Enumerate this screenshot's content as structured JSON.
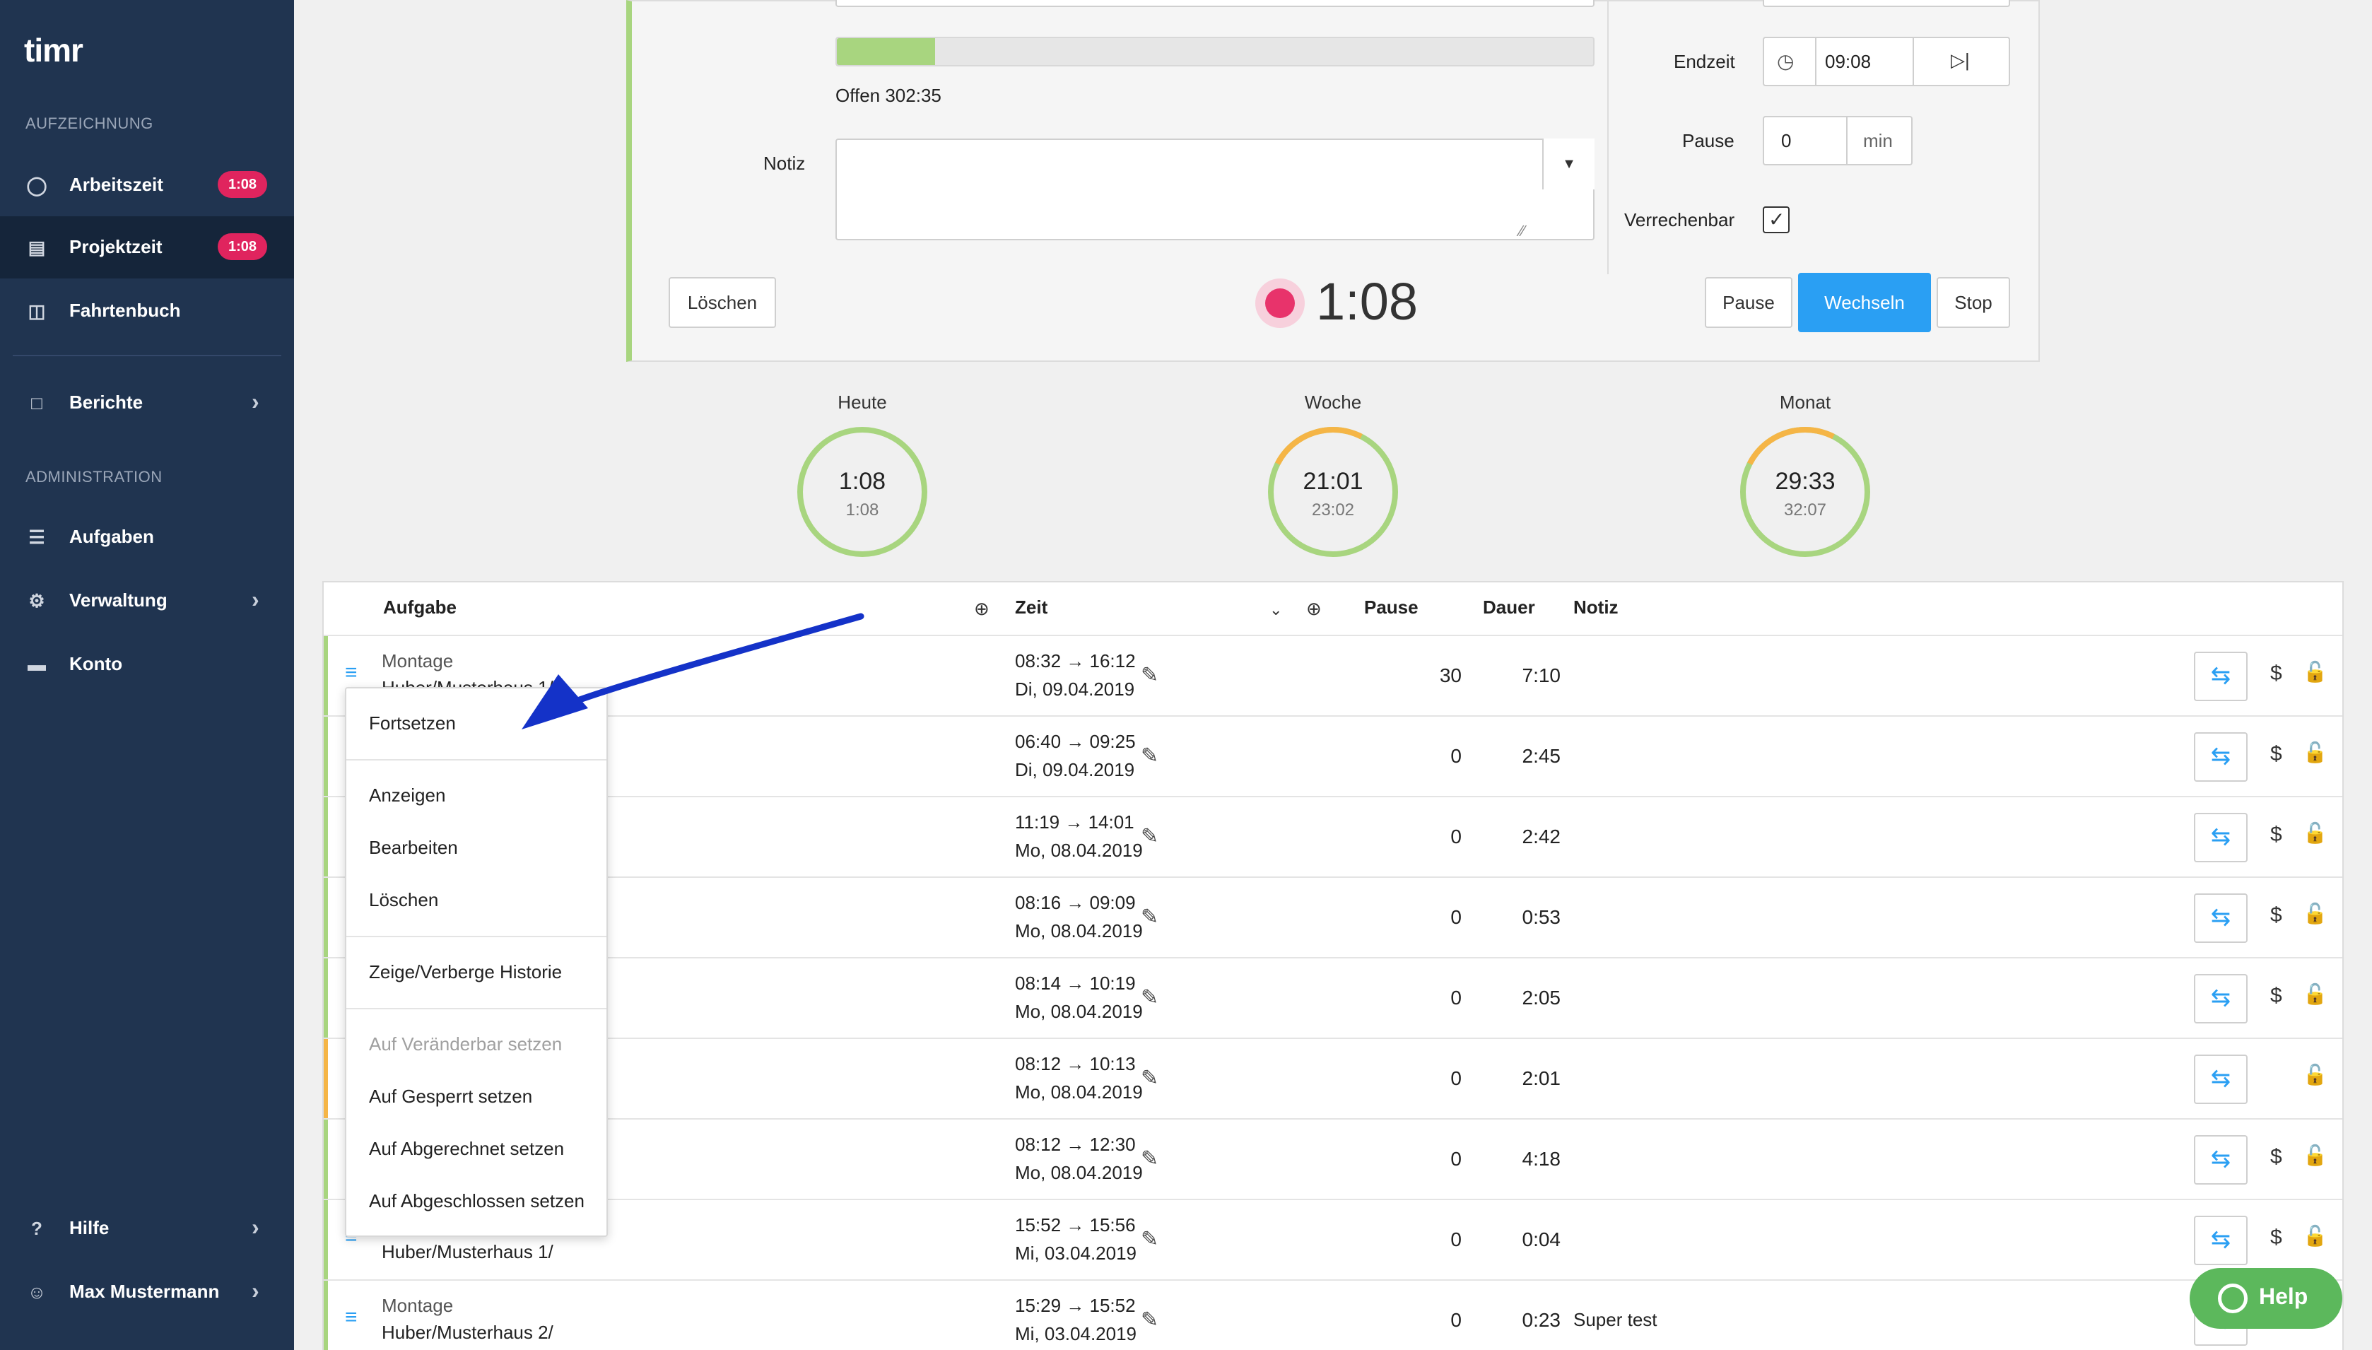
{
  "app": {
    "logo": "timr"
  },
  "sidebar": {
    "section_recording": "AUFZEICHNUNG",
    "section_admin": "ADMINISTRATION",
    "items": [
      {
        "label": "Arbeitszeit",
        "badge": "1:08",
        "icon": "user-clock-icon"
      },
      {
        "label": "Projektzeit",
        "badge": "1:08",
        "icon": "briefcase-clock-icon"
      },
      {
        "label": "Fahrtenbuch",
        "icon": "car-icon"
      },
      {
        "label": "Berichte",
        "icon": "report-icon"
      },
      {
        "label": "Aufgaben",
        "icon": "sitemap-icon"
      },
      {
        "label": "Verwaltung",
        "icon": "gear-icon"
      },
      {
        "label": "Konto",
        "icon": "card-icon"
      },
      {
        "label": "Hilfe",
        "icon": "question-icon"
      },
      {
        "label": "Max Mustermann",
        "icon": "user-icon"
      }
    ]
  },
  "tracker": {
    "progress_fraction": 0.13,
    "open_label": "Offen 302:35",
    "note_label": "Notiz",
    "note_value": "",
    "end_label": "Endzeit",
    "end_value": "09:08",
    "pause_label": "Pause",
    "pause_value": "0",
    "pause_unit": "min",
    "billable_label": "Verrechenbar",
    "billable_checked": true,
    "delete_button": "Löschen",
    "timer": "1:08",
    "pause_button": "Pause",
    "switch_button": "Wechseln",
    "stop_button": "Stop"
  },
  "stats": [
    {
      "label": "Heute",
      "value": "1:08",
      "sub": "1:08"
    },
    {
      "label": "Woche",
      "value": "21:01",
      "sub": "23:02"
    },
    {
      "label": "Monat",
      "value": "29:33",
      "sub": "32:07"
    }
  ],
  "table": {
    "headers": {
      "task": "Aufgabe",
      "time": "Zeit",
      "pause": "Pause",
      "duration": "Dauer",
      "note": "Notiz"
    },
    "rows": [
      {
        "task1": "Montage",
        "task2": "Huber/Musterhaus 1/",
        "range": "08:32 → 16:12",
        "date": "Di, 09.04.2019",
        "pause": "30",
        "dur": "7:10",
        "note": "",
        "billable": true,
        "bar": "green"
      },
      {
        "task1": "",
        "task2": "",
        "range": "06:40 → 09:25",
        "date": "Di, 09.04.2019",
        "pause": "0",
        "dur": "2:45",
        "note": "",
        "billable": true,
        "bar": "green"
      },
      {
        "task1": "",
        "task2": "",
        "range": "11:19 → 14:01",
        "date": "Mo, 08.04.2019",
        "pause": "0",
        "dur": "2:42",
        "note": "",
        "billable": true,
        "bar": "green"
      },
      {
        "task1": "",
        "task2": "",
        "range": "08:16 → 09:09",
        "date": "Mo, 08.04.2019",
        "pause": "0",
        "dur": "0:53",
        "note": "",
        "billable": true,
        "bar": "green"
      },
      {
        "task1": "",
        "task2": "",
        "range": "08:14 → 10:19",
        "date": "Mo, 08.04.2019",
        "pause": "0",
        "dur": "2:05",
        "note": "",
        "billable": true,
        "bar": "green"
      },
      {
        "task1": "",
        "task2": "",
        "range": "08:12 → 10:13",
        "date": "Mo, 08.04.2019",
        "pause": "0",
        "dur": "2:01",
        "note": "",
        "billable": false,
        "bar": "orange"
      },
      {
        "task1": "",
        "task2": "",
        "range": "08:12 → 12:30",
        "date": "Mo, 08.04.2019",
        "pause": "0",
        "dur": "4:18",
        "note": "",
        "billable": true,
        "bar": "green"
      },
      {
        "task1": "",
        "task2": "Huber/Musterhaus 1/",
        "range": "15:52 → 15:56",
        "date": "Mi, 03.04.2019",
        "pause": "0",
        "dur": "0:04",
        "note": "",
        "billable": true,
        "bar": "green"
      },
      {
        "task1": "Montage",
        "task2": "Huber/Musterhaus 2/",
        "range": "15:29 → 15:52",
        "date": "Mi, 03.04.2019",
        "pause": "0",
        "dur": "0:23",
        "note": "Super test",
        "billable": true,
        "bar": "green"
      }
    ]
  },
  "context_menu": {
    "items": [
      {
        "label": "Fortsetzen",
        "disabled": false
      },
      {
        "label": "Anzeigen",
        "disabled": false
      },
      {
        "label": "Bearbeiten",
        "disabled": false
      },
      {
        "label": "Löschen",
        "disabled": false
      },
      {
        "label": "Zeige/Verberge Historie",
        "disabled": false
      },
      {
        "label": "Auf Veränderbar setzen",
        "disabled": true
      },
      {
        "label": "Auf Gesperrt setzen",
        "disabled": false
      },
      {
        "label": "Auf Abgerechnet setzen",
        "disabled": false
      },
      {
        "label": "Auf Abgeschlossen setzen",
        "disabled": false
      }
    ]
  },
  "help_button": "Help",
  "colors": {
    "sidebar": "#203450",
    "accent": "#2a9ff3",
    "badge": "#e0245e",
    "green": "#a8d57f",
    "orange": "#f5b546",
    "arrow": "#1432c8"
  }
}
